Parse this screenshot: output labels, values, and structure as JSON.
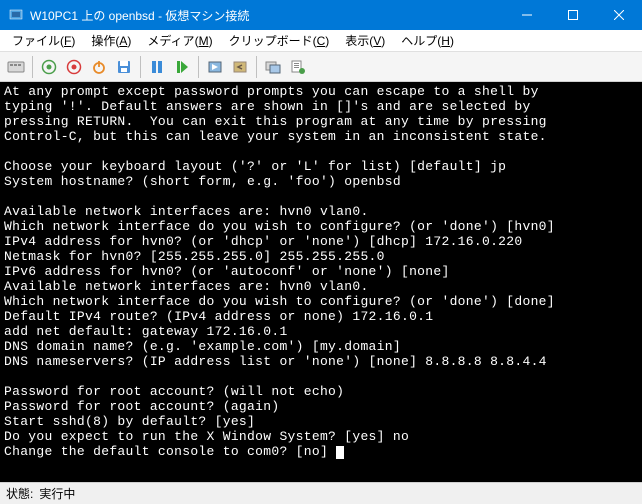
{
  "titlebar": {
    "text": "W10PC1 上の openbsd - 仮想マシン接続"
  },
  "menubar": {
    "items": [
      {
        "label": "ファイル",
        "key": "F"
      },
      {
        "label": "操作",
        "key": "A"
      },
      {
        "label": "メディア",
        "key": "M"
      },
      {
        "label": "クリップボード",
        "key": "C"
      },
      {
        "label": "表示",
        "key": "V"
      },
      {
        "label": "ヘルプ",
        "key": "H"
      }
    ]
  },
  "console_lines": [
    "At any prompt except password prompts you can escape to a shell by",
    "typing '!'. Default answers are shown in []'s and are selected by",
    "pressing RETURN.  You can exit this program at any time by pressing",
    "Control-C, but this can leave your system in an inconsistent state.",
    "",
    "Choose your keyboard layout ('?' or 'L' for list) [default] jp",
    "System hostname? (short form, e.g. 'foo') openbsd",
    "",
    "Available network interfaces are: hvn0 vlan0.",
    "Which network interface do you wish to configure? (or 'done') [hvn0]",
    "IPv4 address for hvn0? (or 'dhcp' or 'none') [dhcp] 172.16.0.220",
    "Netmask for hvn0? [255.255.255.0] 255.255.255.0",
    "IPv6 address for hvn0? (or 'autoconf' or 'none') [none]",
    "Available network interfaces are: hvn0 vlan0.",
    "Which network interface do you wish to configure? (or 'done') [done]",
    "Default IPv4 route? (IPv4 address or none) 172.16.0.1",
    "add net default: gateway 172.16.0.1",
    "DNS domain name? (e.g. 'example.com') [my.domain]",
    "DNS nameservers? (IP address list or 'none') [none] 8.8.8.8 8.8.4.4",
    "",
    "Password for root account? (will not echo)",
    "Password for root account? (again)",
    "Start sshd(8) by default? [yes]",
    "Do you expect to run the X Window System? [yes] no",
    "Change the default console to com0? [no] "
  ],
  "statusbar": {
    "label": "状態:",
    "value": "実行中"
  }
}
